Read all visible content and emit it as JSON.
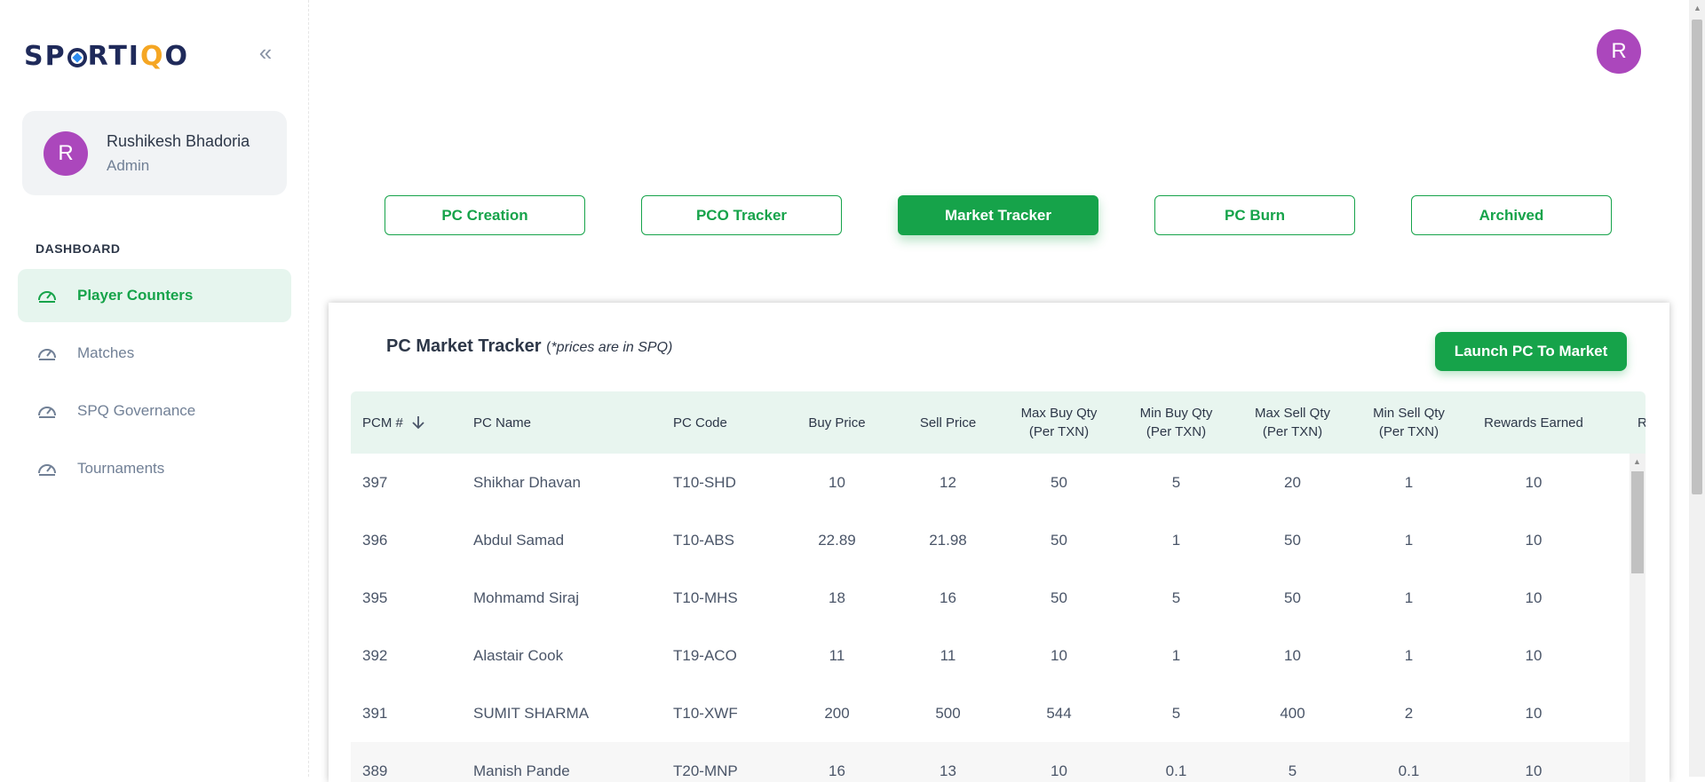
{
  "app": {
    "logo_pre": "SP",
    "logo_post_1": "RTI",
    "logo_accent": "Q",
    "logo_post_2": "O"
  },
  "user": {
    "initial": "R",
    "name": "Rushikesh Bhadoria",
    "role": "Admin"
  },
  "sidebar": {
    "section_label": "DASHBOARD",
    "items": [
      {
        "label": "Player Counters",
        "icon": "speedometer-icon",
        "active": true
      },
      {
        "label": "Matches",
        "icon": "speedometer-icon",
        "active": false
      },
      {
        "label": "SPQ Governance",
        "icon": "speedometer-icon",
        "active": false
      },
      {
        "label": "Tournaments",
        "icon": "speedometer-icon",
        "active": false
      }
    ]
  },
  "header": {
    "avatar_initial": "R"
  },
  "tabs": [
    {
      "label": "PC Creation",
      "active": false
    },
    {
      "label": "PCO Tracker",
      "active": false
    },
    {
      "label": "Market Tracker",
      "active": true
    },
    {
      "label": "PC Burn",
      "active": false
    },
    {
      "label": "Archived",
      "active": false
    }
  ],
  "market": {
    "title": "PC Market Tracker",
    "note_open": "(",
    "note_italic": "*prices are in SPQ)",
    "launch_label": "Launch PC To Market",
    "columns": [
      "PCM #",
      "PC Name",
      "PC Code",
      "Buy Price",
      "Sell Price",
      "Max Buy Qty\n(Per TXN)",
      "Min Buy Qty\n(Per TXN)",
      "Max Sell Qty\n(Per TXN)",
      "Min Sell Qty\n(Per TXN)",
      "Rewards Earned",
      "R"
    ],
    "rows": [
      [
        "397",
        "Shikhar Dhavan",
        "T10-SHD",
        "10",
        "12",
        "50",
        "5",
        "20",
        "1",
        "10"
      ],
      [
        "396",
        "Abdul Samad",
        "T10-ABS",
        "22.89",
        "21.98",
        "50",
        "1",
        "50",
        "1",
        "10"
      ],
      [
        "395",
        "Mohmamd Siraj",
        "T10-MHS",
        "18",
        "16",
        "50",
        "5",
        "50",
        "1",
        "10"
      ],
      [
        "392",
        "Alastair Cook",
        "T19-ACO",
        "11",
        "11",
        "10",
        "1",
        "10",
        "1",
        "10"
      ],
      [
        "391",
        "SUMIT SHARMA",
        "T10-XWF",
        "200",
        "500",
        "544",
        "5",
        "400",
        "2",
        "10"
      ],
      [
        "389",
        "Manish Pande",
        "T20-MNP",
        "16",
        "13",
        "10",
        "0.1",
        "5",
        "0.1",
        "10"
      ]
    ]
  },
  "colors": {
    "accent": "#16a34a",
    "accent_light": "#e6f5ee",
    "avatar": "#ab47bc"
  }
}
